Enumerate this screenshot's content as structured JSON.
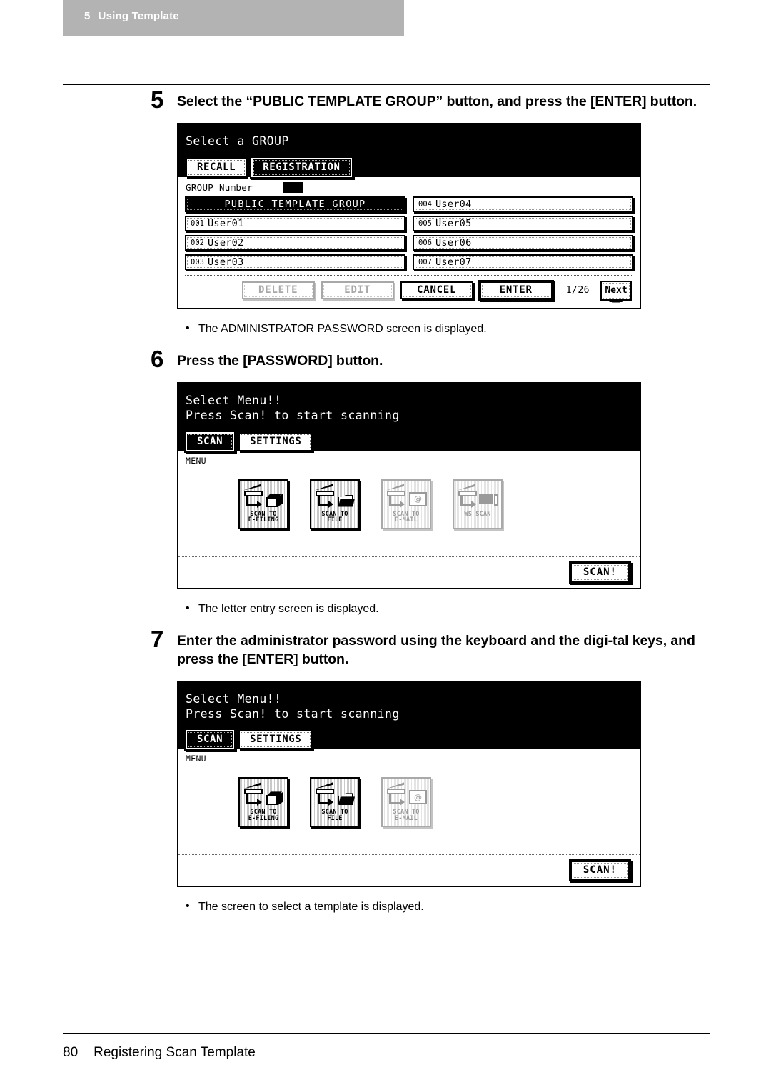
{
  "page_header": {
    "chapter_number": "5",
    "chapter_title": "Using Template"
  },
  "footer": {
    "page_number": "80",
    "section_title": "Registering Scan Template"
  },
  "steps": [
    {
      "number": "5",
      "text": "Select the “PUBLIC TEMPLATE GROUP” button, and press the [ENTER] button."
    },
    {
      "number": "6",
      "text": "Press the [PASSWORD] button."
    },
    {
      "number": "7",
      "text": "Enter the administrator password using the keyboard and the digi-tal keys, and press the [ENTER] button."
    }
  ],
  "notes": [
    {
      "bullet": "•",
      "text": "The ADMINISTRATOR PASSWORD screen is displayed."
    },
    {
      "bullet": "•",
      "text": "The letter entry screen is displayed."
    },
    {
      "bullet": "•",
      "text": "The screen to select a template is displayed."
    }
  ],
  "screen_group": {
    "title": "Select a GROUP",
    "tabs": [
      {
        "label": "RECALL",
        "selected": false
      },
      {
        "label": "REGISTRATION",
        "selected": true
      }
    ],
    "group_number_label": "GROUP Number",
    "group_number_value": "",
    "keys": [
      {
        "index": "",
        "name": "PUBLIC TEMPLATE GROUP",
        "selected": true
      },
      {
        "index": "004",
        "name": "User04",
        "selected": false
      },
      {
        "index": "001",
        "name": "User01",
        "selected": false
      },
      {
        "index": "005",
        "name": "User05",
        "selected": false
      },
      {
        "index": "002",
        "name": "User02",
        "selected": false
      },
      {
        "index": "006",
        "name": "User06",
        "selected": false
      },
      {
        "index": "003",
        "name": "User03",
        "selected": false
      },
      {
        "index": "007",
        "name": "User07",
        "selected": false
      }
    ],
    "actions": [
      {
        "label": "DELETE",
        "state": "disabled"
      },
      {
        "label": "EDIT",
        "state": "disabled"
      },
      {
        "label": "CANCEL",
        "state": "enabled"
      },
      {
        "label": "ENTER",
        "state": "emphasized"
      }
    ],
    "page_indicator": "1/26",
    "next_label": "Next"
  },
  "screen_menu_4": {
    "title": "Select Menu!!",
    "subtitle": "Press Scan! to start scanning",
    "tabs": [
      {
        "label": "SCAN",
        "selected": true
      },
      {
        "label": "SETTINGS",
        "selected": false
      }
    ],
    "menu_label": "MENU",
    "icons": [
      {
        "caption": "SCAN TO\nE-FILING",
        "icon": "scan-to-e-filing-icon",
        "dimmed": false
      },
      {
        "caption": "SCAN TO\nFILE",
        "icon": "scan-to-file-icon",
        "dimmed": false
      },
      {
        "caption": "SCAN TO\nE-MAIL",
        "icon": "scan-to-email-icon",
        "dimmed": true
      },
      {
        "caption": "WS SCAN",
        "icon": "ws-scan-icon",
        "dimmed": true
      }
    ],
    "scan_button": "SCAN!"
  },
  "screen_menu_3": {
    "title": "Select Menu!!",
    "subtitle": "Press Scan! to start scanning",
    "tabs": [
      {
        "label": "SCAN",
        "selected": true
      },
      {
        "label": "SETTINGS",
        "selected": false
      }
    ],
    "menu_label": "MENU",
    "icons": [
      {
        "caption": "SCAN TO\nE-FILING",
        "icon": "scan-to-e-filing-icon",
        "dimmed": false
      },
      {
        "caption": "SCAN TO\nFILE",
        "icon": "scan-to-file-icon",
        "dimmed": false
      },
      {
        "caption": "SCAN TO\nE-MAIL",
        "icon": "scan-to-email-icon",
        "dimmed": true
      }
    ],
    "scan_button": "SCAN!"
  },
  "colors": {
    "header_band": "#b3b3b3",
    "text": "#000000",
    "lcd_header_bg": "#000000",
    "disabled": "#a8a8a8"
  }
}
